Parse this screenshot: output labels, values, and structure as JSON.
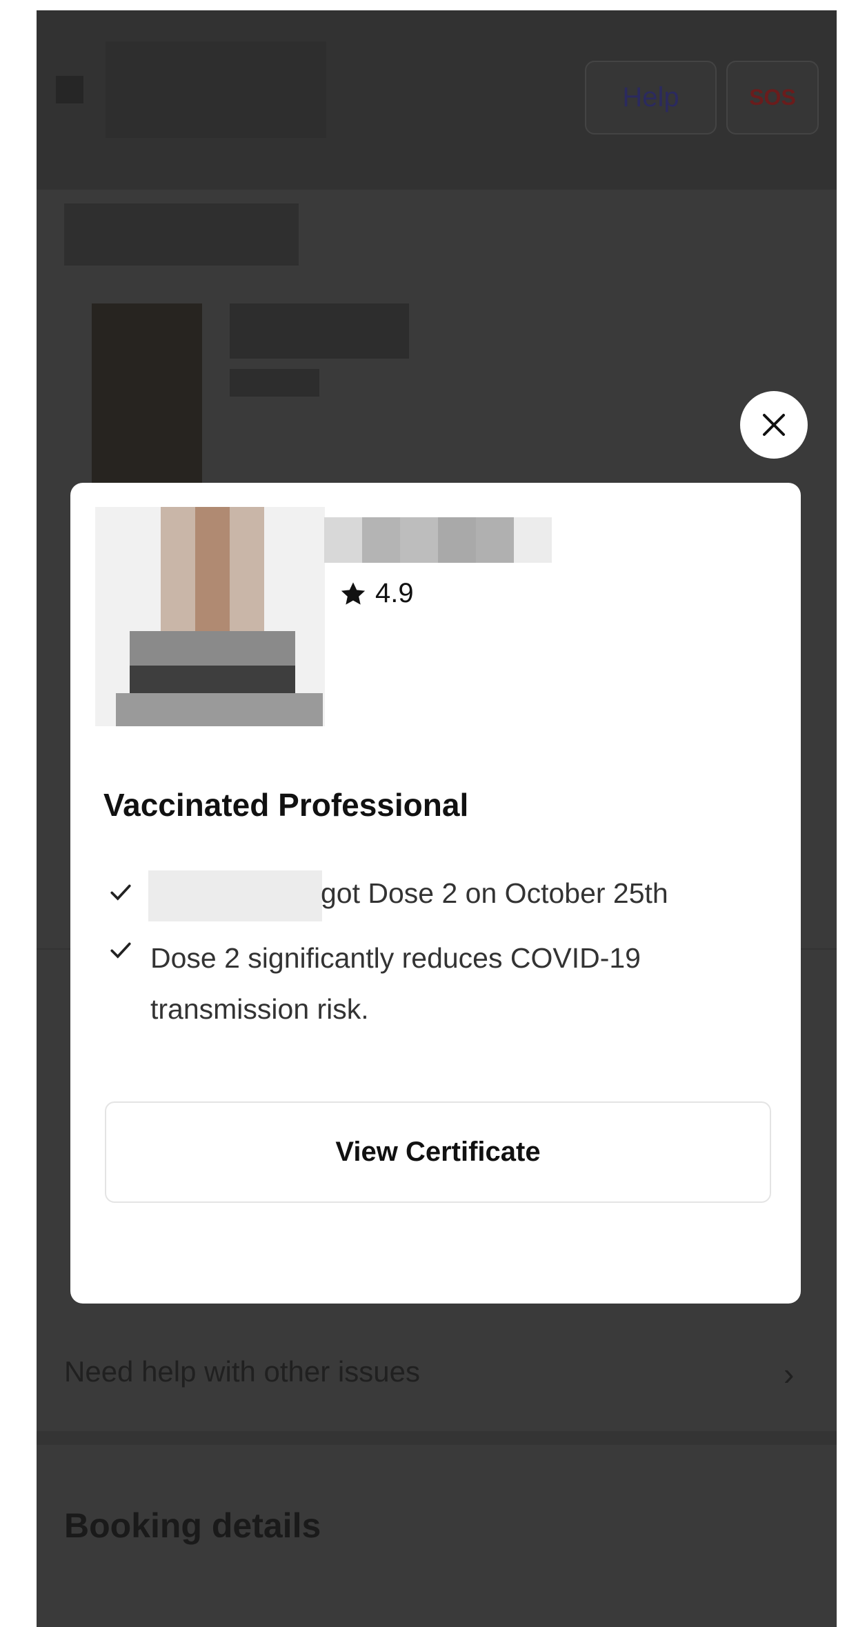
{
  "header": {
    "help_label": "Help",
    "sos_label": "SOS"
  },
  "background": {
    "need_help_label": "Need help with other issues",
    "booking_details_title": "Booking details"
  },
  "modal": {
    "rating": "4.9",
    "title": "Vaccinated Professional",
    "items": [
      {
        "text": "got Dose 2 on October 25th"
      },
      {
        "text": "Dose 2 significantly reduces COVID-19 transmission risk."
      }
    ],
    "view_certificate_label": "View Certificate"
  },
  "icons": {
    "close": "close-icon",
    "star": "star-icon",
    "check": "check-icon",
    "chevron": "chevron-right-icon"
  },
  "colors": {
    "help_text": "#2b2a5e",
    "sos_text": "#6a1c1c",
    "overlay": "#3a3a3a"
  }
}
